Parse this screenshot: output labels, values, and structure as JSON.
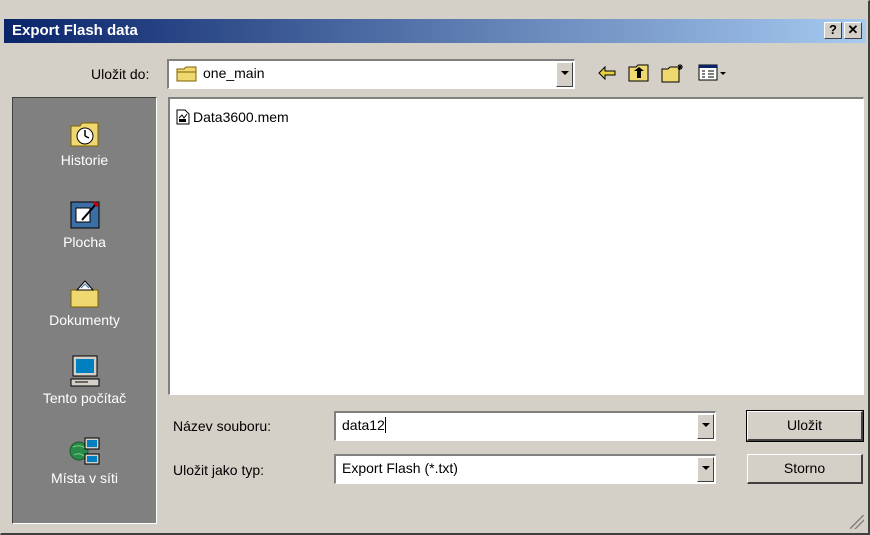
{
  "window": {
    "title": "Export Flash data",
    "help_label": "?",
    "close_label": "✕"
  },
  "toolbar": {
    "save_in_label": "Uložit do:",
    "save_in_value": "one_main"
  },
  "places": [
    {
      "label": "Historie",
      "icon": "history-icon"
    },
    {
      "label": "Plocha",
      "icon": "desktop-icon"
    },
    {
      "label": "Dokumenty",
      "icon": "documents-icon"
    },
    {
      "label": "Tento počítač",
      "icon": "my-computer-icon"
    },
    {
      "label": "Místa v síti",
      "icon": "network-places-icon"
    }
  ],
  "files": [
    {
      "name": "Data3600.mem",
      "icon": "mem-file-icon"
    }
  ],
  "form": {
    "filename_label": "Název souboru:",
    "filename_value": "data12",
    "filetype_label": "Uložit jako typ:",
    "filetype_value": "Export Flash (*.txt)"
  },
  "buttons": {
    "save": "Uložit",
    "cancel": "Storno"
  }
}
